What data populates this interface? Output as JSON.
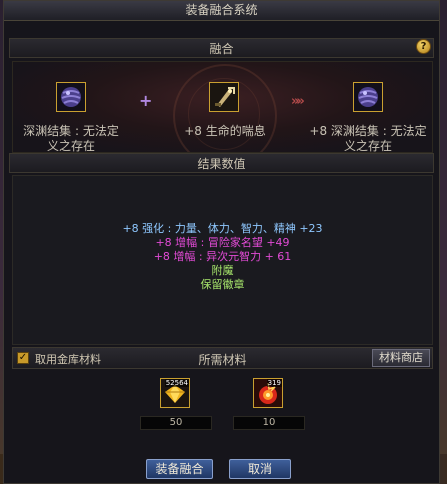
{
  "window": {
    "title": "装备融合系统"
  },
  "fusion": {
    "section_title": "融合",
    "help_label": "?",
    "left_item": {
      "name": "深渊结集 : 无法定义之存在",
      "name_line1": "深渊结集 : 无法定",
      "name_line2": "义之存在",
      "icon": "abyss-orb-icon"
    },
    "plus_symbol": "+",
    "middle_item": {
      "name": "+8 生命的喘息",
      "icon": "weapon-icon"
    },
    "arrow_symbol": "»»",
    "result_item": {
      "name_line1": "+8 深渊结集 : 无法定",
      "name_line2": "义之存在",
      "icon": "abyss-orb-icon"
    }
  },
  "result": {
    "section_title": "结果数值",
    "lines": [
      {
        "text": "+8 强化 : 力量、体力、智力、精神 +23",
        "color": "#8fc8ff"
      },
      {
        "text": "+8 增幅 : 冒险家名望 +49",
        "color": "#e24bd6"
      },
      {
        "text": "+8 增幅 : 异次元智力 + 61",
        "color": "#e24bd6"
      },
      {
        "text": "附魔",
        "color": "#a6e46b"
      },
      {
        "text": "保留徽章",
        "color": "#a6e46b"
      }
    ]
  },
  "materials": {
    "checkbox_label": "取用金库材料",
    "checkbox_checked": true,
    "section_title": "所需材料",
    "shop_button": "材料商店",
    "items": [
      {
        "icon": "gold-crystal-icon",
        "owned": "52564",
        "required": "50"
      },
      {
        "icon": "red-spark-icon",
        "owned": "319",
        "required": "10"
      }
    ]
  },
  "footer": {
    "fuse_button": "装备融合",
    "cancel_button": "取消"
  }
}
